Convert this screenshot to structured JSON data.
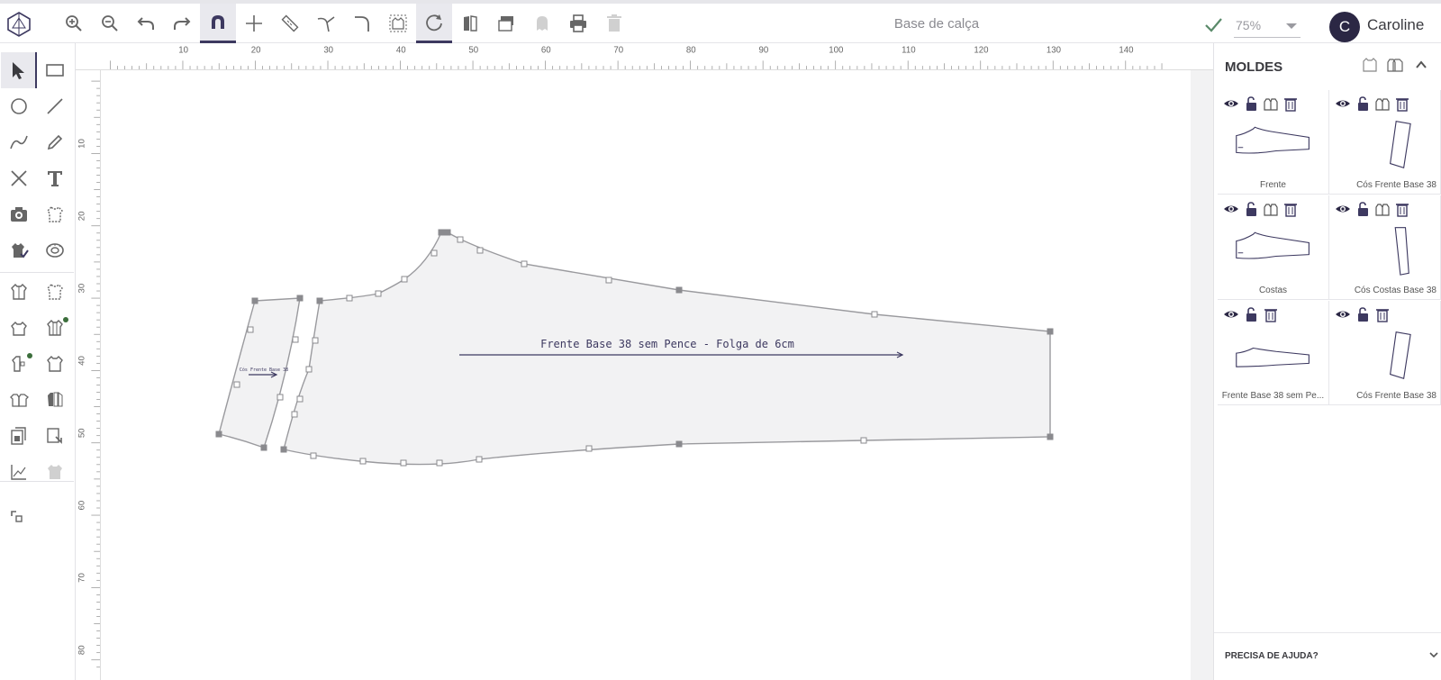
{
  "app": {
    "logo_icon": "geodesic-logo-icon",
    "doc_title": "Base de calça",
    "zoom_value": "75%",
    "user_initial": "C",
    "user_name": "Caroline",
    "accent_color": "#3d3960",
    "pattern_fill": "#f2f2f3",
    "pattern_stroke": "#9a9a9e"
  },
  "toolbar": [
    {
      "name": "zoom-in-icon",
      "active": false,
      "disabled": false
    },
    {
      "name": "zoom-out-icon",
      "active": false,
      "disabled": false
    },
    {
      "name": "undo-icon",
      "active": false,
      "disabled": false
    },
    {
      "name": "redo-icon",
      "active": false,
      "disabled": false
    },
    {
      "name": "magnet-icon",
      "active": true,
      "disabled": false
    },
    {
      "name": "crosshair-icon",
      "active": false,
      "disabled": false
    },
    {
      "name": "ruler-icon",
      "active": false,
      "disabled": false
    },
    {
      "name": "curve-split-icon",
      "active": false,
      "disabled": false
    },
    {
      "name": "corner-curve-icon",
      "active": false,
      "disabled": false
    },
    {
      "name": "shirt-select-icon",
      "active": false,
      "disabled": false
    },
    {
      "name": "refresh-icon",
      "active": true,
      "disabled": false
    },
    {
      "name": "mirror-piece-icon",
      "active": false,
      "disabled": false
    },
    {
      "name": "stack-icon",
      "active": false,
      "disabled": false
    },
    {
      "name": "ghost-icon",
      "active": false,
      "disabled": true
    },
    {
      "name": "print-icon",
      "active": false,
      "disabled": false
    },
    {
      "name": "trash-icon",
      "active": false,
      "disabled": true
    }
  ],
  "tools": [
    {
      "name": "pointer-icon",
      "active": true
    },
    {
      "name": "rectangle-icon"
    },
    {
      "name": "circle-icon"
    },
    {
      "name": "line-icon"
    },
    {
      "name": "curve-icon"
    },
    {
      "name": "pencil-icon"
    },
    {
      "name": "cross-icon"
    },
    {
      "name": "text-icon"
    },
    {
      "name": "camera-icon"
    },
    {
      "name": "shirt-outline-icon"
    },
    {
      "name": "shirt-check-icon"
    },
    {
      "name": "tape-measure-icon"
    },
    {
      "name": "shirt-front-icon"
    },
    {
      "name": "shirt-dot-icon"
    },
    {
      "name": "shirt-plus-icon"
    },
    {
      "name": "shirt-back-icon"
    },
    {
      "name": "half-shirt-icon"
    },
    {
      "name": "shirt-alt-icon"
    },
    {
      "name": "shirt-multi-icon"
    },
    {
      "name": "shirt-group-icon"
    },
    {
      "name": "doc-copy-icon"
    },
    {
      "name": "doc-link-icon"
    },
    {
      "name": "axes-icon"
    },
    {
      "name": "shirt-faded-icon",
      "disabled": true
    },
    {
      "name": "scan-icon"
    }
  ],
  "rulers": {
    "top": [
      "10",
      "20",
      "30",
      "40",
      "50",
      "60",
      "70",
      "80",
      "90",
      "100",
      "110",
      "120",
      "130",
      "140"
    ],
    "left": [
      "10",
      "20",
      "30",
      "40",
      "50",
      "60",
      "70",
      "80"
    ]
  },
  "canvas": {
    "main_label": "Frente Base 38 sem Pence - Folga de 6cm",
    "small_label": "Cós Frente Base 38"
  },
  "panel": {
    "title": "MOLDES",
    "help": "PRECISA DE AJUDA?",
    "cards": [
      {
        "label": "Frente",
        "shape": "pants"
      },
      {
        "label": "Cós Frente Base 38",
        "shape": "band"
      },
      {
        "label": "Costas",
        "shape": "pants"
      },
      {
        "label": "Cós Costas Base 38",
        "shape": "band2"
      },
      {
        "label": "Frente Base 38 sem Pe...",
        "shape": "pants-thin"
      },
      {
        "label": "Cós Frente Base 38",
        "shape": "band"
      }
    ]
  }
}
